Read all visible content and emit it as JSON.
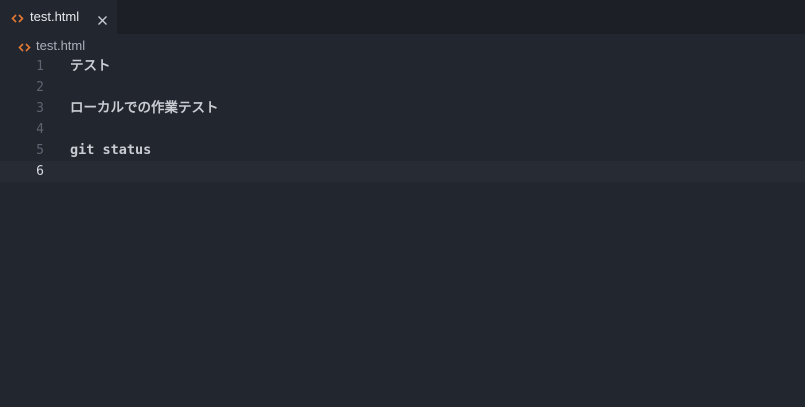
{
  "tab": {
    "label": "test.html",
    "icon": "html-file-icon",
    "close_icon": "close-icon"
  },
  "breadcrumb": {
    "label": "test.html",
    "icon": "html-file-icon"
  },
  "editor": {
    "current_line": 6,
    "lines": [
      {
        "number": "1",
        "text": "テスト"
      },
      {
        "number": "2",
        "text": ""
      },
      {
        "number": "3",
        "text": "ローカルでの作業テスト"
      },
      {
        "number": "4",
        "text": ""
      },
      {
        "number": "5",
        "text": "git status"
      },
      {
        "number": "6",
        "text": ""
      }
    ]
  },
  "colors": {
    "background": "#22262e",
    "tabbar": "#1c1f26",
    "html_icon": "#e37933",
    "current_line": "#272b34"
  }
}
